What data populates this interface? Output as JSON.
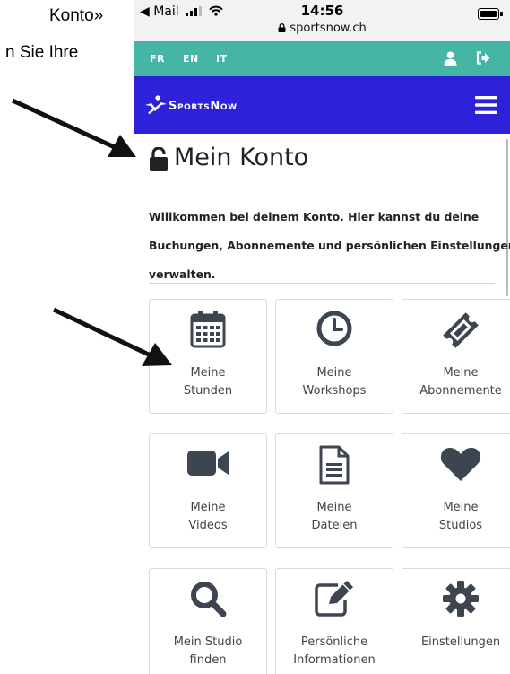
{
  "instruction": {
    "line1": "Konto»",
    "line2": "n Sie Ihre"
  },
  "statusbar": {
    "back_app": "◀ Mail",
    "time": "14:56",
    "url": "sportsnow.ch"
  },
  "languages": [
    "FR",
    "EN",
    "IT"
  ],
  "navbar": {
    "logo_text": "SportsNow"
  },
  "page": {
    "title": "Mein Konto",
    "intro_lines": [
      "Willkommen bei deinem Konto. Hier kannst du deine",
      "Buchungen, Abonnemente und persönlichen Einstellungen",
      "verwalten."
    ]
  },
  "tiles": [
    {
      "icon": "calendar-icon",
      "line1": "Meine",
      "line2": "Stunden"
    },
    {
      "icon": "clock-icon",
      "line1": "Meine",
      "line2": "Workshops"
    },
    {
      "icon": "ticket-icon",
      "line1": "Meine",
      "line2": "Abonnemente"
    },
    {
      "icon": "video-camera-icon",
      "line1": "Meine",
      "line2": "Videos"
    },
    {
      "icon": "document-icon",
      "line1": "Meine",
      "line2": "Dateien"
    },
    {
      "icon": "heart-icon",
      "line1": "Meine",
      "line2": "Studios"
    },
    {
      "icon": "search-icon",
      "line1": "Mein Studio",
      "line2": "finden"
    },
    {
      "icon": "edit-icon",
      "line1": "Persönliche",
      "line2": "Informationen"
    },
    {
      "icon": "gear-icon",
      "line1": "Einstellungen",
      "line2": ""
    }
  ],
  "colors": {
    "lang_bar": "#45b5a4",
    "nav_bar": "#2d22d9",
    "icon": "#3d4550"
  }
}
